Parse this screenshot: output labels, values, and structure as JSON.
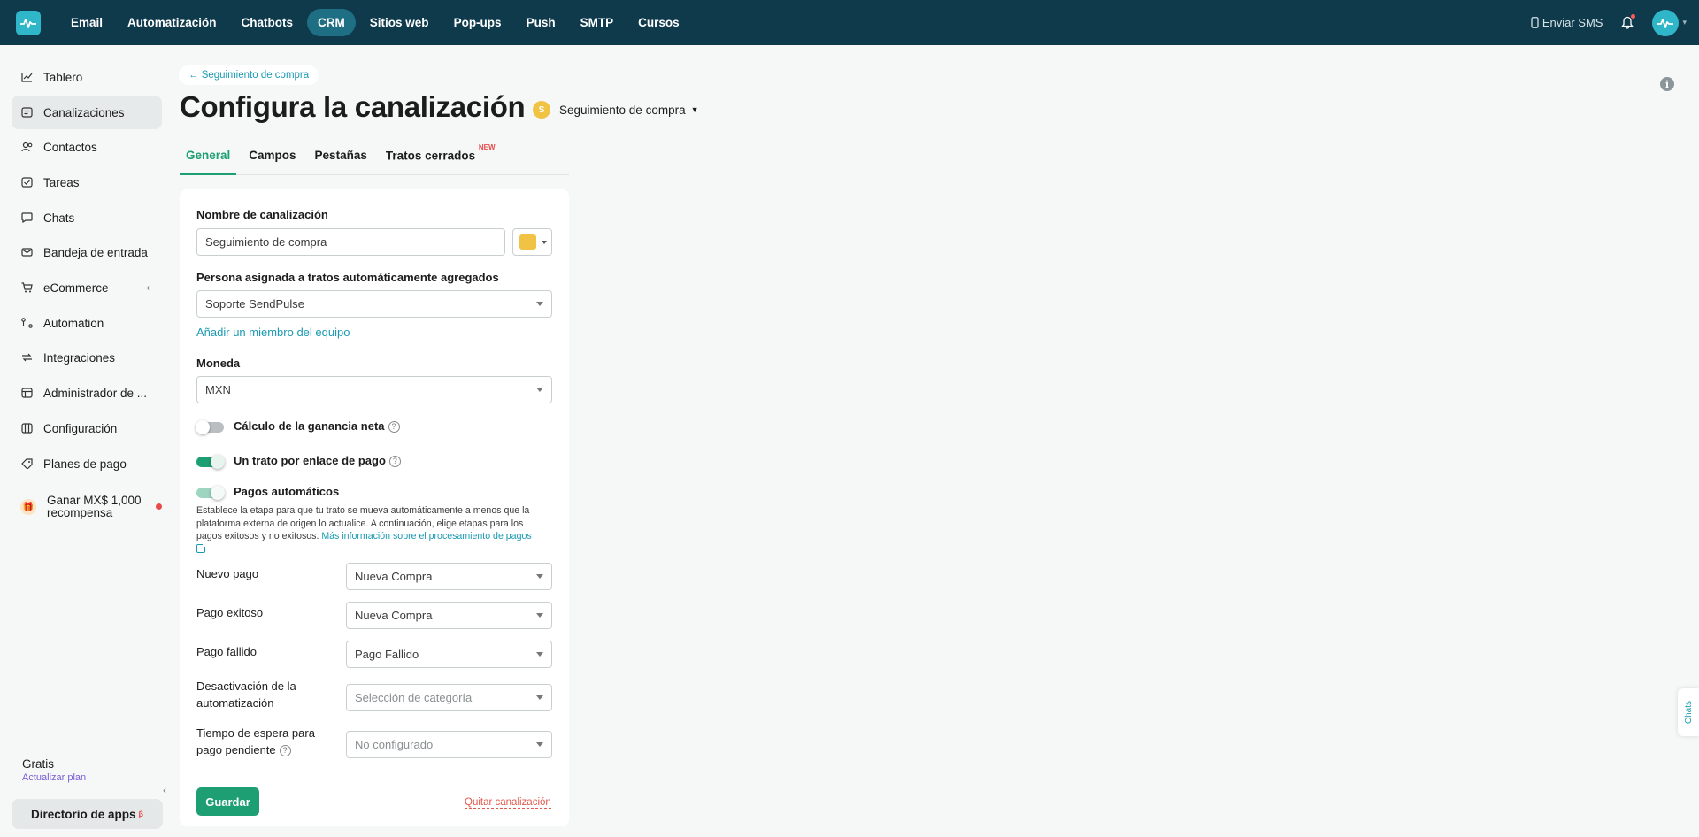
{
  "topbar": {
    "nav": [
      "Email",
      "Automatización",
      "Chatbots",
      "CRM",
      "Sitios web",
      "Pop-ups",
      "Push",
      "SMTP",
      "Cursos"
    ],
    "active_nav": "CRM",
    "sms_label": "Enviar SMS"
  },
  "sidebar": {
    "items": [
      {
        "label": "Tablero",
        "icon": "chart-line-icon"
      },
      {
        "label": "Canalizaciones",
        "icon": "pipeline-icon"
      },
      {
        "label": "Contactos",
        "icon": "contacts-icon"
      },
      {
        "label": "Tareas",
        "icon": "tasks-icon"
      },
      {
        "label": "Chats",
        "icon": "chat-icon"
      },
      {
        "label": "Bandeja de entrada",
        "icon": "inbox-icon"
      },
      {
        "label": "eCommerce",
        "icon": "cart-icon"
      },
      {
        "label": "Automation",
        "icon": "automation-icon"
      },
      {
        "label": "Integraciones",
        "icon": "integrations-icon"
      },
      {
        "label": "Administrador de ...",
        "icon": "admin-icon"
      },
      {
        "label": "Configuración",
        "icon": "settings-icon"
      },
      {
        "label": "Planes de pago",
        "icon": "plans-icon"
      }
    ],
    "reward_line1": "Ganar MX$ 1,000",
    "reward_line2": "recompensa",
    "plan_name": "Gratis",
    "upgrade_label": "Actualizar plan",
    "app_directory": "Directorio de apps",
    "app_directory_sup": "β"
  },
  "breadcrumb": "← Seguimiento de compra",
  "page_title": "Configura la canalización",
  "pipeline_selector": {
    "initial": "S",
    "label": "Seguimiento de compra"
  },
  "tabs": [
    {
      "label": "General"
    },
    {
      "label": "Campos"
    },
    {
      "label": "Pestañas"
    },
    {
      "label": "Tratos cerrados",
      "badge": "NEW"
    }
  ],
  "form": {
    "name_label": "Nombre de canalización",
    "name_value": "Seguimiento de compra",
    "color": "#f0c345",
    "assignee_label": "Persona asignada a tratos automáticamente agregados",
    "assignee_value": "Soporte SendPulse",
    "add_member": "Añadir un miembro del equipo",
    "currency_label": "Moneda",
    "currency_value": "MXN",
    "net_profit_label": "Cálculo de la ganancia neta",
    "net_profit_on": false,
    "one_deal_label": "Un trato por enlace de pago",
    "one_deal_on": true,
    "auto_payments_label": "Pagos automáticos",
    "auto_payments_on": true,
    "description": "Establece la etapa para que tu trato se mueva automáticamente a menos que la plataforma externa de origen lo actualice. A continuación, elige etapas para los pagos exitosos y no exitosos.",
    "more_info": "Más información sobre el procesamiento de pagos",
    "new_payment_label": "Nuevo pago",
    "new_payment_value": "Nueva Compra",
    "success_label": "Pago exitoso",
    "success_value": "Nueva Compra",
    "failed_label": "Pago fallido",
    "failed_value": "Pago Fallido",
    "deactivation_label_1": "Desactivación de la",
    "deactivation_label_2": "automatización",
    "deactivation_placeholder": "Selección de categoría",
    "wait_label_1": "Tiempo de espera para",
    "wait_label_2": "pago pendiente",
    "wait_value": "No configurado",
    "save": "Guardar",
    "remove": "Quitar canalización"
  },
  "chats_tab": "Chats",
  "colors": {
    "topbar": "#0e3a4c",
    "accent": "#1e9e73",
    "link": "#1a9ab3",
    "danger": "#e05a4e"
  }
}
